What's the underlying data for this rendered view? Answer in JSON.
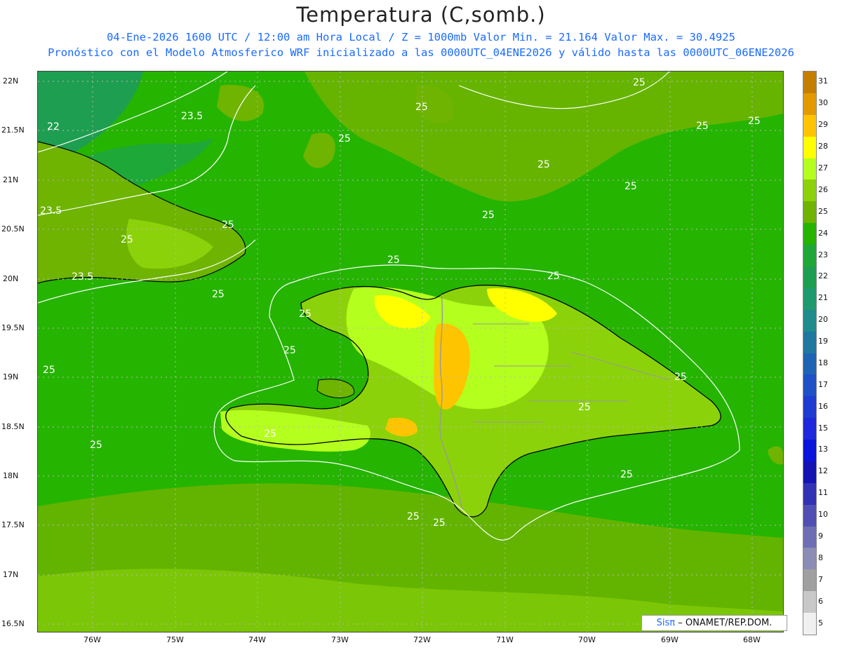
{
  "title": "Temperatura (C,somb.)",
  "subtitle_line1": "04-Ene-2026 1600 UTC / 12:00 am Hora Local / Z = 1000mb   Valor Min. = 21.164  Valor Max. = 30.4925",
  "subtitle_line2": "Pronóstico con el Modelo Atmosferico WRF inicializado a las 0000UTC_04ENE2026 y válido hasta las  0000UTC_06ENE2026",
  "credit": {
    "brand": "Sisπ",
    "org": "– ONAMET/REP.DOM."
  },
  "lat_labels": [
    "22N",
    "21.5N",
    "21N",
    "20.5N",
    "20N",
    "19.5N",
    "19N",
    "18.5N",
    "18N",
    "17.5N",
    "17N",
    "16.5N"
  ],
  "lon_labels": [
    "76W",
    "75W",
    "74W",
    "73W",
    "72W",
    "71W",
    "70W",
    "69W",
    "68W"
  ],
  "colorbar": {
    "labels": [
      "31",
      "30",
      "29",
      "28",
      "27",
      "26",
      "25",
      "24",
      "23",
      "22",
      "21",
      "20",
      "19",
      "18",
      "17",
      "16",
      "15",
      "13",
      "12",
      "11",
      "10",
      "9",
      "8",
      "7",
      "6",
      "5"
    ],
    "colors": [
      "#c47f00",
      "#e39a00",
      "#ffc400",
      "#ffff00",
      "#b4ff1e",
      "#8cd20a",
      "#6eb400",
      "#25b400",
      "#1ea838",
      "#1e9e50",
      "#1e9a6e",
      "#1e8c8c",
      "#1e78a0",
      "#1e64b4",
      "#1e50c8",
      "#1e3cd2",
      "#1e28dc",
      "#0a14dc",
      "#1414b4",
      "#3232b4",
      "#5050b4",
      "#6e6eb4",
      "#8c8cb4",
      "#a0a0a0",
      "#c8c8c8",
      "#f0f0f0"
    ]
  },
  "contour_labels": [
    "22",
    "23.5",
    "23.5",
    "23.5",
    "25"
  ],
  "colors": {
    "sea": "#25b400",
    "sea_dark": "#1e9e50",
    "land_low": "#6eb400",
    "land_mid": "#8cd20a",
    "land_high": "#b4ff1e",
    "land_hot": "#ffff00",
    "land_hottest": "#ffc400",
    "subtitle": "#1a6bff"
  },
  "chart_data": {
    "type": "heatmap",
    "variable": "Temperatura",
    "unit": "C",
    "level": "1000mb",
    "min": 21.164,
    "max": 30.4925,
    "lat_range": [
      16.4,
      22.1
    ],
    "lon_range": [
      -76.6,
      -67.6
    ]
  }
}
